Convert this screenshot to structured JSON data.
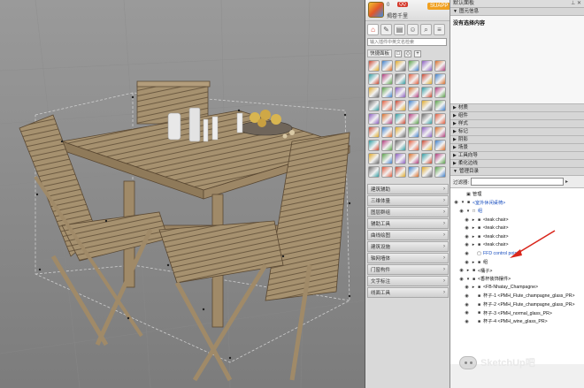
{
  "plugin": {
    "user": "0",
    "tag": "QQ",
    "name": "揭卷千里",
    "app_badge": "SUAPP",
    "search_placeholder": "输入插件中英文名检索",
    "quick_label": "快捷面板",
    "categories": [
      "建筑辅助",
      "三维体量",
      "图层群组",
      "辅助工具",
      "曲线绘图",
      "建筑设施",
      "轴网墙体",
      "门窗构件",
      "文字标注",
      "线面工具"
    ]
  },
  "tray": {
    "title": "默认面板",
    "info_header": "图元信息",
    "info_body": "没有选择内容",
    "sections": [
      "材质",
      "组件",
      "样式",
      "标记",
      "阴影",
      "场景",
      "工具向导",
      "柔化边线"
    ],
    "outliner_header": "管理目录",
    "filter_label": "过滤器:",
    "outliner_items": [
      {
        "indent": 0,
        "exp": "",
        "icon": "▣",
        "label": "管理",
        "eye": false,
        "blue": false
      },
      {
        "indent": 0,
        "exp": "▾",
        "icon": "■",
        "label": "<室外休闲桌椅>",
        "eye": true,
        "blue": true
      },
      {
        "indent": 1,
        "exp": "▾",
        "icon": "□",
        "label": "组",
        "eye": true,
        "blue": true
      },
      {
        "indent": 2,
        "exp": "▸",
        "icon": "■",
        "label": "<teak chair>",
        "eye": true,
        "blue": false
      },
      {
        "indent": 2,
        "exp": "▸",
        "icon": "■",
        "label": "<teak chair>",
        "eye": true,
        "blue": false
      },
      {
        "indent": 2,
        "exp": "▸",
        "icon": "■",
        "label": "<teak chair>",
        "eye": true,
        "blue": false
      },
      {
        "indent": 2,
        "exp": "▸",
        "icon": "■",
        "label": "<teak chair>",
        "eye": true,
        "blue": false
      },
      {
        "indent": 2,
        "exp": "",
        "icon": "▢",
        "label": "FFD control points",
        "eye": true,
        "blue": true
      },
      {
        "indent": 2,
        "exp": "▸",
        "icon": "■",
        "label": "组",
        "eye": true,
        "blue": false
      },
      {
        "indent": 1,
        "exp": "▸",
        "icon": "■",
        "label": "<桶子>",
        "eye": true,
        "blue": false
      },
      {
        "indent": 1,
        "exp": "▾",
        "icon": "■",
        "label": "<香杯装饰摆件>",
        "eye": true,
        "blue": false
      },
      {
        "indent": 2,
        "exp": "▸",
        "icon": "■",
        "label": "<FB-Nhatay_Champagne>",
        "eye": true,
        "blue": false
      },
      {
        "indent": 2,
        "exp": "",
        "icon": "■",
        "label": "杯子-1 <PMH_Flute_champagne_glass_PR>",
        "eye": true,
        "blue": false
      },
      {
        "indent": 2,
        "exp": "",
        "icon": "■",
        "label": "杯子-2 <PMH_Flute_champagne_glass_PR>",
        "eye": true,
        "blue": false
      },
      {
        "indent": 2,
        "exp": "",
        "icon": "■",
        "label": "杯子-3 <PMH_normal_glass_PR>",
        "eye": true,
        "blue": false
      },
      {
        "indent": 2,
        "exp": "",
        "icon": "■",
        "label": "杯子-4 <PMH_wine_glass_PR>",
        "eye": true,
        "blue": false
      }
    ]
  },
  "watermark": "SketchUp吧",
  "colors": {
    "accent_red": "#d23c2c",
    "selection_blue": "#1a4fbf",
    "wood": "#a89478"
  }
}
